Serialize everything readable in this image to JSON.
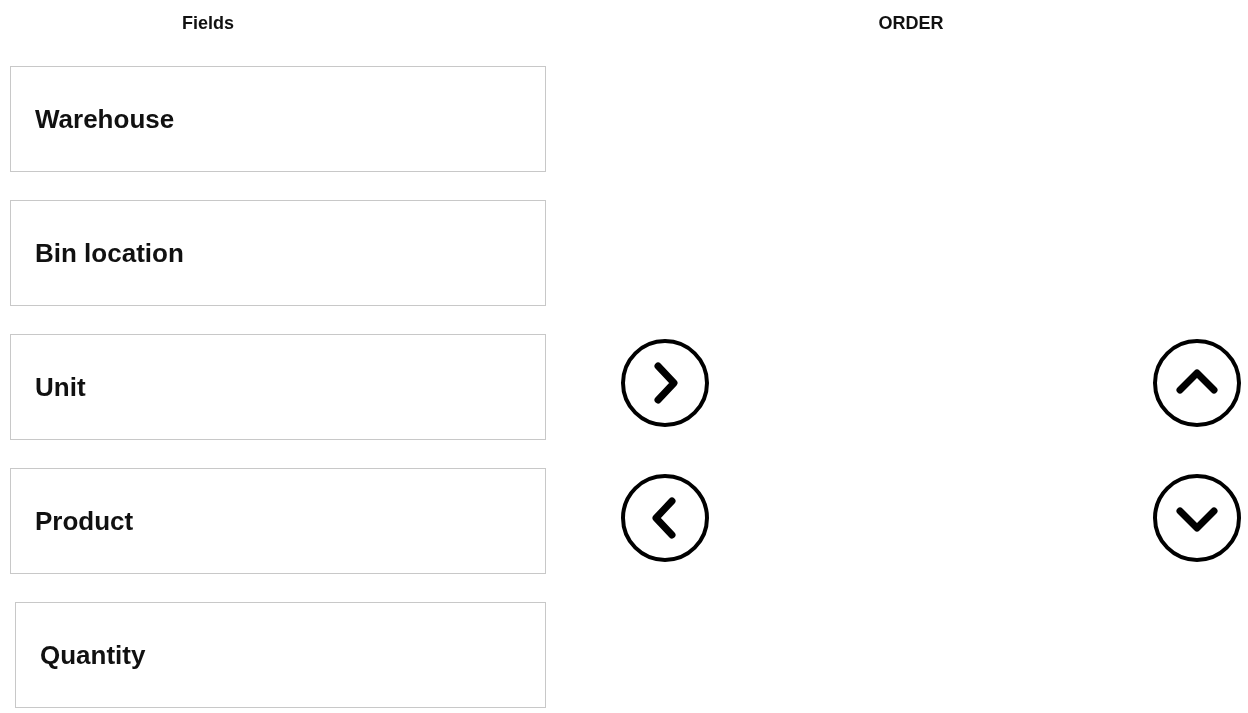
{
  "headers": {
    "fields": "Fields",
    "order": "ORDER"
  },
  "fields": [
    {
      "label": "Warehouse"
    },
    {
      "label": "Bin location"
    },
    {
      "label": "Unit"
    },
    {
      "label": "Product"
    },
    {
      "label": "Quantity"
    }
  ],
  "move_buttons": [
    {
      "kind": "right"
    },
    {
      "kind": "left"
    }
  ],
  "order_buttons": [
    {
      "kind": "up"
    },
    {
      "kind": "down"
    }
  ]
}
